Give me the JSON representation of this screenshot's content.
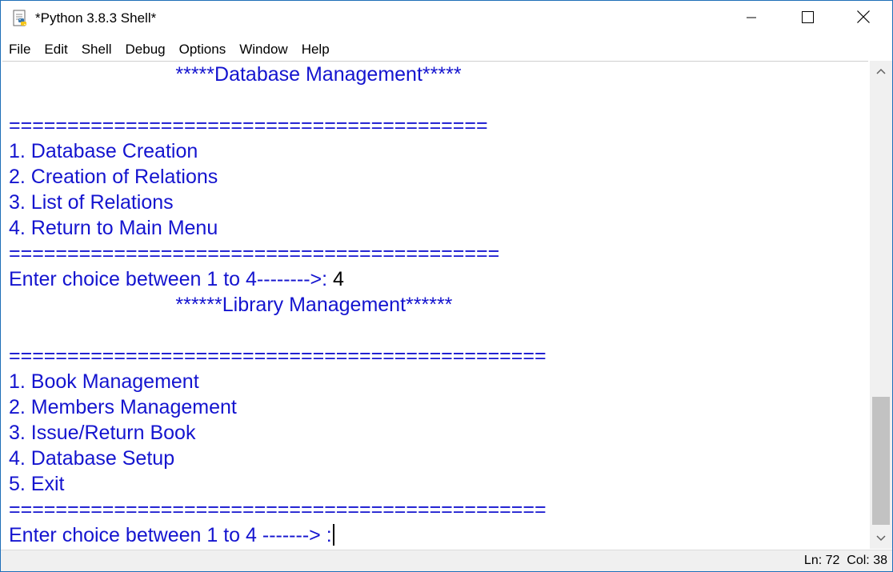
{
  "window": {
    "title": "*Python 3.8.3 Shell*"
  },
  "menu": [
    "File",
    "Edit",
    "Shell",
    "Debug",
    "Options",
    "Window",
    "Help"
  ],
  "shell_lines": [
    {
      "text": "                              *****Database Management*****",
      "input": ""
    },
    {
      "text": "",
      "input": ""
    },
    {
      "text": "=========================================",
      "input": ""
    },
    {
      "text": "1. Database Creation",
      "input": ""
    },
    {
      "text": "2. Creation of Relations",
      "input": ""
    },
    {
      "text": "3. List of Relations",
      "input": ""
    },
    {
      "text": "4. Return to Main Menu",
      "input": ""
    },
    {
      "text": "==========================================",
      "input": ""
    },
    {
      "text": "Enter choice between 1 to 4-------->: ",
      "input": "4"
    },
    {
      "text": "                              ******Library Management******",
      "input": ""
    },
    {
      "text": "",
      "input": ""
    },
    {
      "text": "==============================================",
      "input": ""
    },
    {
      "text": "1. Book Management",
      "input": ""
    },
    {
      "text": "2. Members Management",
      "input": ""
    },
    {
      "text": "3. Issue/Return Book",
      "input": ""
    },
    {
      "text": "4. Database Setup",
      "input": ""
    },
    {
      "text": "5. Exit",
      "input": ""
    },
    {
      "text": "==============================================",
      "input": ""
    },
    {
      "text": "Enter choice between 1 to 4 -------> :",
      "input": ""
    }
  ],
  "status": {
    "text": "Ln: 72  Col: 38"
  },
  "colors": {
    "output": "#1414cf",
    "input": "#000000"
  },
  "icons": {
    "app": "python-idle-icon",
    "minimize": "minimize-icon",
    "maximize": "maximize-icon",
    "close": "close-icon"
  }
}
